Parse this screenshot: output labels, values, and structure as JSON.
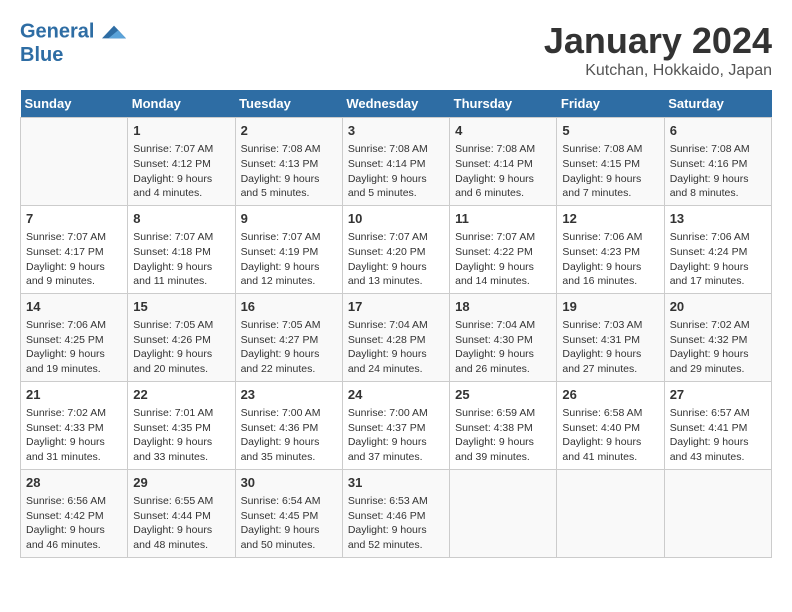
{
  "header": {
    "logo_general": "General",
    "logo_blue": "Blue",
    "title": "January 2024",
    "subtitle": "Kutchan, Hokkaido, Japan"
  },
  "columns": [
    "Sunday",
    "Monday",
    "Tuesday",
    "Wednesday",
    "Thursday",
    "Friday",
    "Saturday"
  ],
  "weeks": [
    [
      {
        "day": "",
        "info": ""
      },
      {
        "day": "1",
        "info": "Sunrise: 7:07 AM\nSunset: 4:12 PM\nDaylight: 9 hours\nand 4 minutes."
      },
      {
        "day": "2",
        "info": "Sunrise: 7:08 AM\nSunset: 4:13 PM\nDaylight: 9 hours\nand 5 minutes."
      },
      {
        "day": "3",
        "info": "Sunrise: 7:08 AM\nSunset: 4:14 PM\nDaylight: 9 hours\nand 5 minutes."
      },
      {
        "day": "4",
        "info": "Sunrise: 7:08 AM\nSunset: 4:14 PM\nDaylight: 9 hours\nand 6 minutes."
      },
      {
        "day": "5",
        "info": "Sunrise: 7:08 AM\nSunset: 4:15 PM\nDaylight: 9 hours\nand 7 minutes."
      },
      {
        "day": "6",
        "info": "Sunrise: 7:08 AM\nSunset: 4:16 PM\nDaylight: 9 hours\nand 8 minutes."
      }
    ],
    [
      {
        "day": "7",
        "info": "Sunrise: 7:07 AM\nSunset: 4:17 PM\nDaylight: 9 hours\nand 9 minutes."
      },
      {
        "day": "8",
        "info": "Sunrise: 7:07 AM\nSunset: 4:18 PM\nDaylight: 9 hours\nand 11 minutes."
      },
      {
        "day": "9",
        "info": "Sunrise: 7:07 AM\nSunset: 4:19 PM\nDaylight: 9 hours\nand 12 minutes."
      },
      {
        "day": "10",
        "info": "Sunrise: 7:07 AM\nSunset: 4:20 PM\nDaylight: 9 hours\nand 13 minutes."
      },
      {
        "day": "11",
        "info": "Sunrise: 7:07 AM\nSunset: 4:22 PM\nDaylight: 9 hours\nand 14 minutes."
      },
      {
        "day": "12",
        "info": "Sunrise: 7:06 AM\nSunset: 4:23 PM\nDaylight: 9 hours\nand 16 minutes."
      },
      {
        "day": "13",
        "info": "Sunrise: 7:06 AM\nSunset: 4:24 PM\nDaylight: 9 hours\nand 17 minutes."
      }
    ],
    [
      {
        "day": "14",
        "info": "Sunrise: 7:06 AM\nSunset: 4:25 PM\nDaylight: 9 hours\nand 19 minutes."
      },
      {
        "day": "15",
        "info": "Sunrise: 7:05 AM\nSunset: 4:26 PM\nDaylight: 9 hours\nand 20 minutes."
      },
      {
        "day": "16",
        "info": "Sunrise: 7:05 AM\nSunset: 4:27 PM\nDaylight: 9 hours\nand 22 minutes."
      },
      {
        "day": "17",
        "info": "Sunrise: 7:04 AM\nSunset: 4:28 PM\nDaylight: 9 hours\nand 24 minutes."
      },
      {
        "day": "18",
        "info": "Sunrise: 7:04 AM\nSunset: 4:30 PM\nDaylight: 9 hours\nand 26 minutes."
      },
      {
        "day": "19",
        "info": "Sunrise: 7:03 AM\nSunset: 4:31 PM\nDaylight: 9 hours\nand 27 minutes."
      },
      {
        "day": "20",
        "info": "Sunrise: 7:02 AM\nSunset: 4:32 PM\nDaylight: 9 hours\nand 29 minutes."
      }
    ],
    [
      {
        "day": "21",
        "info": "Sunrise: 7:02 AM\nSunset: 4:33 PM\nDaylight: 9 hours\nand 31 minutes."
      },
      {
        "day": "22",
        "info": "Sunrise: 7:01 AM\nSunset: 4:35 PM\nDaylight: 9 hours\nand 33 minutes."
      },
      {
        "day": "23",
        "info": "Sunrise: 7:00 AM\nSunset: 4:36 PM\nDaylight: 9 hours\nand 35 minutes."
      },
      {
        "day": "24",
        "info": "Sunrise: 7:00 AM\nSunset: 4:37 PM\nDaylight: 9 hours\nand 37 minutes."
      },
      {
        "day": "25",
        "info": "Sunrise: 6:59 AM\nSunset: 4:38 PM\nDaylight: 9 hours\nand 39 minutes."
      },
      {
        "day": "26",
        "info": "Sunrise: 6:58 AM\nSunset: 4:40 PM\nDaylight: 9 hours\nand 41 minutes."
      },
      {
        "day": "27",
        "info": "Sunrise: 6:57 AM\nSunset: 4:41 PM\nDaylight: 9 hours\nand 43 minutes."
      }
    ],
    [
      {
        "day": "28",
        "info": "Sunrise: 6:56 AM\nSunset: 4:42 PM\nDaylight: 9 hours\nand 46 minutes."
      },
      {
        "day": "29",
        "info": "Sunrise: 6:55 AM\nSunset: 4:44 PM\nDaylight: 9 hours\nand 48 minutes."
      },
      {
        "day": "30",
        "info": "Sunrise: 6:54 AM\nSunset: 4:45 PM\nDaylight: 9 hours\nand 50 minutes."
      },
      {
        "day": "31",
        "info": "Sunrise: 6:53 AM\nSunset: 4:46 PM\nDaylight: 9 hours\nand 52 minutes."
      },
      {
        "day": "",
        "info": ""
      },
      {
        "day": "",
        "info": ""
      },
      {
        "day": "",
        "info": ""
      }
    ]
  ]
}
